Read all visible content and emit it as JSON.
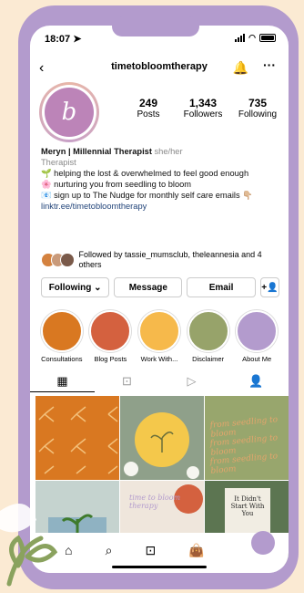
{
  "status": {
    "time": "18:07 ➤"
  },
  "header": {
    "username": "timetobloomtherapy",
    "back": "‹",
    "bell": "🔔",
    "more": "···"
  },
  "profile": {
    "initials": "b"
  },
  "stats": [
    {
      "n": "249",
      "l": "Posts"
    },
    {
      "n": "1,343",
      "l": "Followers"
    },
    {
      "n": "735",
      "l": "Following"
    }
  ],
  "bio": {
    "name": "Meryn | Millennial Therapist",
    "pronouns": "she/her",
    "category": "Therapist",
    "line1": "🌱 helping the lost & overwhelmed to feel good enough",
    "line2": "🌸 nurturing you from seedling to bloom",
    "line3": "📧 sign up to The Nudge for monthly self care emails 👇🏼",
    "link": "linktr.ee/timetobloomtherapy"
  },
  "followed": {
    "text": "Followed by tassie_mumsclub, theleannesia and 4 others"
  },
  "buttons": {
    "following": "Following ⌄",
    "message": "Message",
    "email": "Email",
    "add": "+👤"
  },
  "highlights": [
    {
      "label": "Consultations",
      "color": "#d97821"
    },
    {
      "label": "Blog Posts",
      "color": "#d4613f"
    },
    {
      "label": "Work With...",
      "color": "#f6b94b"
    },
    {
      "label": "Disclaimer",
      "color": "#97a36a"
    },
    {
      "label": "About Me",
      "color": "#b39bcd"
    }
  ],
  "tabs": [
    "▦",
    "⊡",
    "▷",
    "👤"
  ],
  "posts": {
    "p3": "from seedling to bloom",
    "p5": "time to bloom therapy",
    "p6": "It Didn't Start With You"
  },
  "nav": [
    "⌂",
    "⌕",
    "⊡",
    "👜"
  ]
}
